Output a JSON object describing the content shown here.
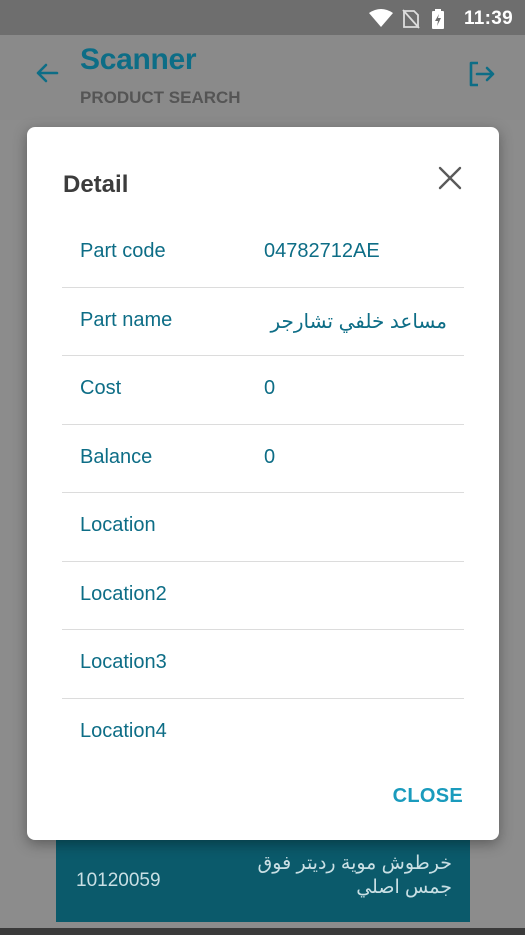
{
  "status_bar": {
    "time": "11:39",
    "icons": [
      "wifi-icon",
      "no-sim-icon",
      "battery-charging-icon"
    ]
  },
  "app_bar": {
    "title": "Scanner",
    "subtitle": "PRODUCT SEARCH",
    "icons": [
      "back-arrow-icon",
      "logout-icon"
    ]
  },
  "background_item": {
    "code": "10120059",
    "name": "خرطوش موية رديتر فوق جمس اصلي"
  },
  "dialog": {
    "title": "Detail",
    "close_label": "CLOSE",
    "rows": [
      {
        "label": "Part code",
        "value": "04782712AE"
      },
      {
        "label": "Part name",
        "value": "مساعد خلفي تشارجر"
      },
      {
        "label": "Cost",
        "value": "0"
      },
      {
        "label": "Balance",
        "value": "0"
      },
      {
        "label": "Location",
        "value": ""
      },
      {
        "label": "Location2",
        "value": ""
      },
      {
        "label": "Location3",
        "value": ""
      },
      {
        "label": "Location4",
        "value": ""
      }
    ]
  },
  "colors": {
    "accent": "#0d6d86",
    "button": "#1a9bbd",
    "list_item_bg": "#0b5a6b"
  }
}
